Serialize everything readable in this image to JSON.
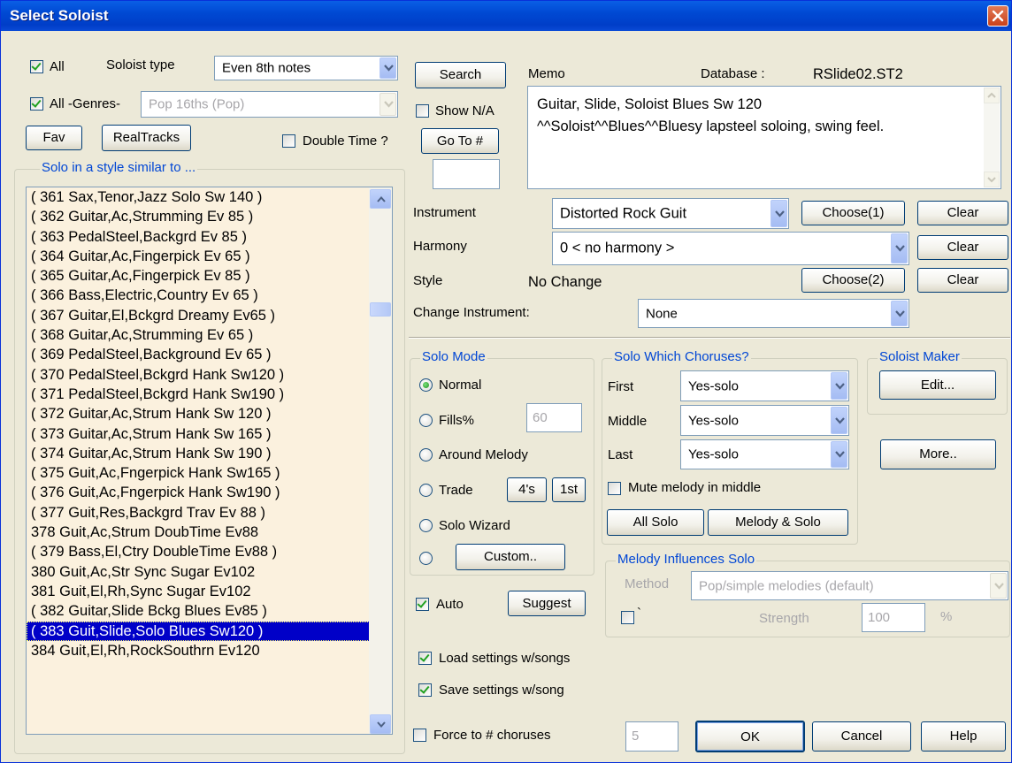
{
  "dialog": {
    "title": "Select Soloist"
  },
  "filters": {
    "all_label": "All",
    "soloist_type_label": "Soloist type",
    "soloist_type_value": "Even 8th notes",
    "all_genres_label": "All -Genres-",
    "genre_value": "Pop 16ths (Pop)",
    "fav_label": "Fav",
    "realtracks_label": "RealTracks",
    "double_time_label": "Double Time ?"
  },
  "list": {
    "group_label": "Solo in a style similar to ...",
    "items": [
      "( 361 Sax,Tenor,Jazz Solo Sw 140 )",
      "( 362 Guitar,Ac,Strumming Ev 85 )",
      "( 363 PedalSteel,Backgrd Ev 85 )",
      "( 364 Guitar,Ac,Fingerpick Ev 65 )",
      "( 365 Guitar,Ac,Fingerpick Ev 85 )",
      "( 366 Bass,Electric,Country Ev 65 )",
      "( 367 Guitar,El,Bckgrd Dreamy Ev65 )",
      "( 368 Guitar,Ac,Strumming Ev 65 )",
      "( 369 PedalSteel,Background Ev 65 )",
      "( 370 PedalSteel,Bckgrd Hank Sw120 )",
      "( 371 PedalSteel,Bckgrd Hank Sw190 )",
      "( 372 Guitar,Ac,Strum Hank Sw 120 )",
      "( 373 Guitar,Ac,Strum Hank Sw 165 )",
      "( 374 Guitar,Ac,Strum Hank Sw 190 )",
      "( 375 Guit,Ac,Fngerpick Hank Sw165 )",
      "( 376 Guit,Ac,Fngerpick Hank Sw190 )",
      "( 377 Guit,Res,Backgrd Trav Ev 88 )",
      "378 Guit,Ac,Strum DoubTime Ev88",
      "( 379 Bass,El,Ctry DoubleTime Ev88 )",
      "380 Guit,Ac,Str Sync Sugar Ev102",
      "381 Guit,El,Rh,Sync Sugar Ev102",
      "( 382 Guitar,Slide Bckg Blues Ev85 )",
      "( 383 Guit,Slide,Solo Blues Sw120 )",
      "384 Guit,El,Rh,RockSouthrn Ev120"
    ],
    "selected_index": 22
  },
  "search": {
    "search_label": "Search",
    "show_na_label": "Show N/A",
    "goto_label": "Go To #",
    "goto_value": ""
  },
  "memo": {
    "label": "Memo",
    "database_label": "Database :",
    "database_value": "RSlide02.ST2",
    "line1": "Guitar, Slide, Soloist Blues Sw 120",
    "line2": "^^Soloist^^Blues^^Bluesy lapsteel soloing, swing feel."
  },
  "instrument": {
    "label": "Instrument",
    "value": "Distorted Rock Guit",
    "choose_label": "Choose(1)",
    "clear_label": "Clear"
  },
  "harmony": {
    "label": "Harmony",
    "value": "0 < no harmony >",
    "clear_label": "Clear"
  },
  "style": {
    "label": "Style",
    "value": "No Change",
    "choose_label": "Choose(2)",
    "clear_label": "Clear"
  },
  "change_instrument": {
    "label": "Change Instrument:",
    "value": "None"
  },
  "solo_mode": {
    "group_label": "Solo Mode",
    "normal_label": "Normal",
    "fills_label": "Fills%",
    "fills_value": "60",
    "around_melody_label": "Around Melody",
    "trade_label": "Trade",
    "trade_4s_label": "4's",
    "trade_1st_label": "1st",
    "solo_wizard_label": "Solo Wizard",
    "custom_label": "Custom..",
    "selected": "Normal"
  },
  "choruses": {
    "group_label": "Solo Which Choruses?",
    "first_label": "First",
    "first_value": "Yes-solo",
    "middle_label": "Middle",
    "middle_value": "Yes-solo",
    "last_label": "Last",
    "last_value": "Yes-solo",
    "mute_label": "Mute melody in middle",
    "all_solo_label": "All Solo",
    "melody_solo_label": "Melody & Solo"
  },
  "soloist_maker": {
    "group_label": "Soloist Maker",
    "edit_label": "Edit...",
    "more_label": "More.."
  },
  "melody_influences": {
    "group_label": "Melody Influences Solo",
    "method_label": "Method",
    "method_value": "Pop/simple melodies (default)",
    "checkbox_label": "`",
    "strength_label": "Strength",
    "strength_value": "100",
    "percent_label": "%"
  },
  "bottom": {
    "auto_label": "Auto",
    "suggest_label": "Suggest",
    "load_label": "Load settings w/songs",
    "save_label": "Save settings w/song",
    "force_label": "Force to # choruses",
    "force_value": "5",
    "ok_label": "OK",
    "cancel_label": "Cancel",
    "help_label": "Help"
  },
  "colors": {
    "title_bar": "#0054E3",
    "selection": "#0000C8",
    "list_background": "#FBF1DE",
    "group_label": "#0046D5"
  }
}
